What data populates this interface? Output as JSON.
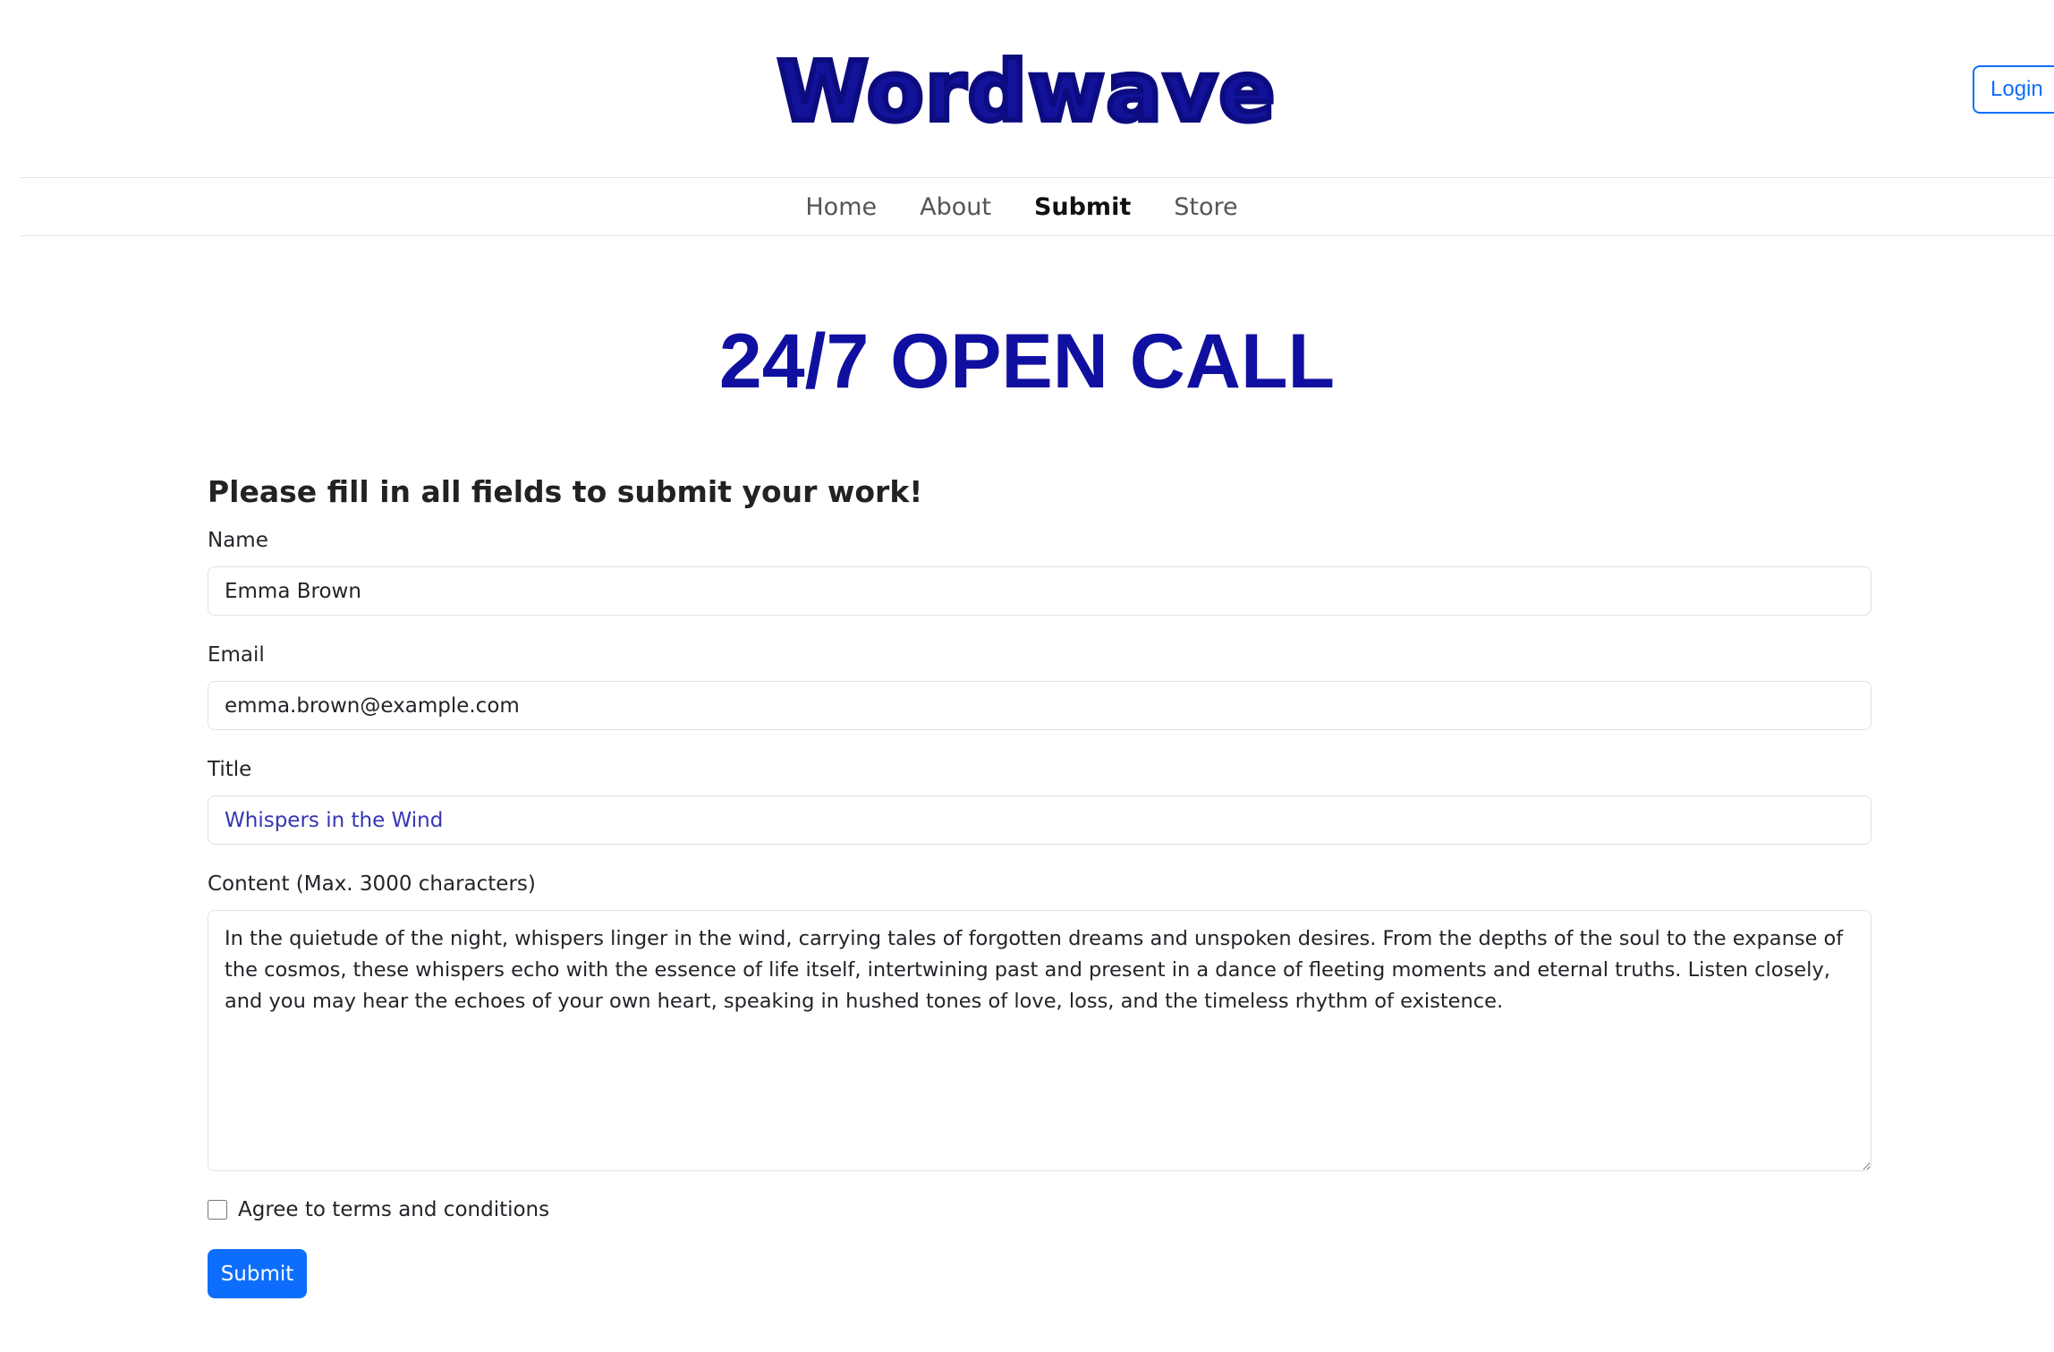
{
  "header": {
    "logo_text": "Wordwave",
    "login_label": "Login"
  },
  "nav": {
    "items": [
      {
        "label": "Home",
        "active": false
      },
      {
        "label": "About",
        "active": false
      },
      {
        "label": "Submit",
        "active": true
      },
      {
        "label": "Store",
        "active": false
      }
    ]
  },
  "main": {
    "title": "24/7 OPEN CALL"
  },
  "form": {
    "heading": "Please fill in all fields to submit your work!",
    "name": {
      "label": "Name",
      "value": "Emma Brown"
    },
    "email": {
      "label": "Email",
      "value": "emma.brown@example.com"
    },
    "title": {
      "label": "Title",
      "value": "Whispers in the Wind"
    },
    "content": {
      "label": "Content (Max. 3000 characters)",
      "value": "In the quietude of the night, whispers linger in the wind, carrying tales of forgotten dreams and unspoken desires. From the depths of the soul to the expanse of the cosmos, these whispers echo with the essence of life itself, intertwining past and present in a dance of fleeting moments and eternal truths. Listen closely, and you may hear the echoes of your own heart, speaking in hushed tones of love, loss, and the timeless rhythm of existence."
    },
    "terms_label": "Agree to terms and conditions",
    "terms_checked": false,
    "submit_label": "Submit"
  },
  "colors": {
    "brand": "#12129a",
    "title": "#1010a0",
    "primary": "#0d6efd"
  }
}
